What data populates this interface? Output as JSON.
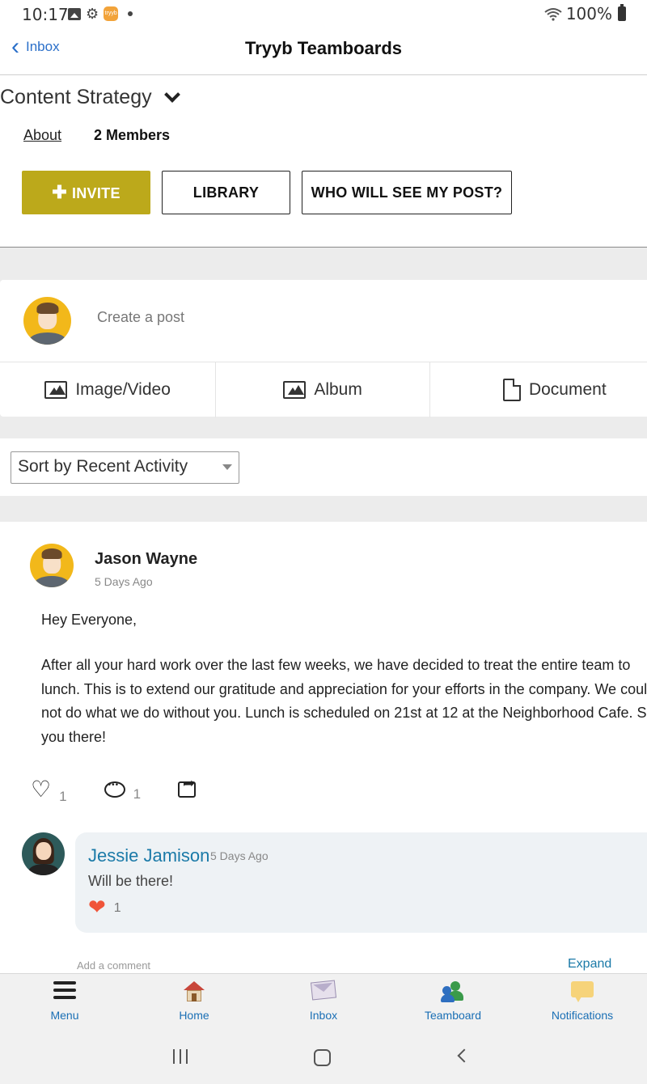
{
  "status_bar": {
    "time": "10:17",
    "battery": "100%"
  },
  "header": {
    "back_label": "Inbox",
    "title": "Tryyb Teamboards"
  },
  "group": {
    "title": "Content Strategy",
    "about_label": "About",
    "members_label": "2 Members",
    "invite_label": "INVITE",
    "library_label": "LIBRARY",
    "who_label": "WHO WILL SEE MY POST?"
  },
  "composer": {
    "placeholder": "Create a post",
    "media": [
      "Image/Video",
      "Album",
      "Document"
    ]
  },
  "sort": {
    "selected": "Sort by Recent Activity"
  },
  "post": {
    "author": "Jason Wayne",
    "time": "5 Days Ago",
    "greeting": "Hey Everyone,",
    "body_lines": [
      "After all your hard work over the last few weeks, we have decided to treat the entire team to",
      "lunch. This is to extend our gratitude and appreciation for your efforts in the company. We could",
      "not do what we do without you. Lunch is scheduled on 21st at 12 at the Neighborhood Cafe. See",
      "you there!"
    ],
    "likes": "1",
    "comments": "1"
  },
  "comment": {
    "author": "Jessie Jamison",
    "time": "5 Days Ago",
    "text": "Will be there!",
    "likes": "1"
  },
  "comment_input": {
    "placeholder": "Add a comment",
    "expand_label": "Expand"
  },
  "bottom_nav": {
    "items": [
      {
        "label": "Menu",
        "icon": "menu-icon"
      },
      {
        "label": "Home",
        "icon": "home-icon"
      },
      {
        "label": "Inbox",
        "icon": "inbox-icon"
      },
      {
        "label": "Teamboard",
        "icon": "teamboard-icon"
      },
      {
        "label": "Notifications",
        "icon": "notifications-icon"
      }
    ]
  },
  "colors": {
    "accent_invite": "#bca91b",
    "link_blue": "#1a6fb5",
    "heart_red": "#f0553a"
  }
}
